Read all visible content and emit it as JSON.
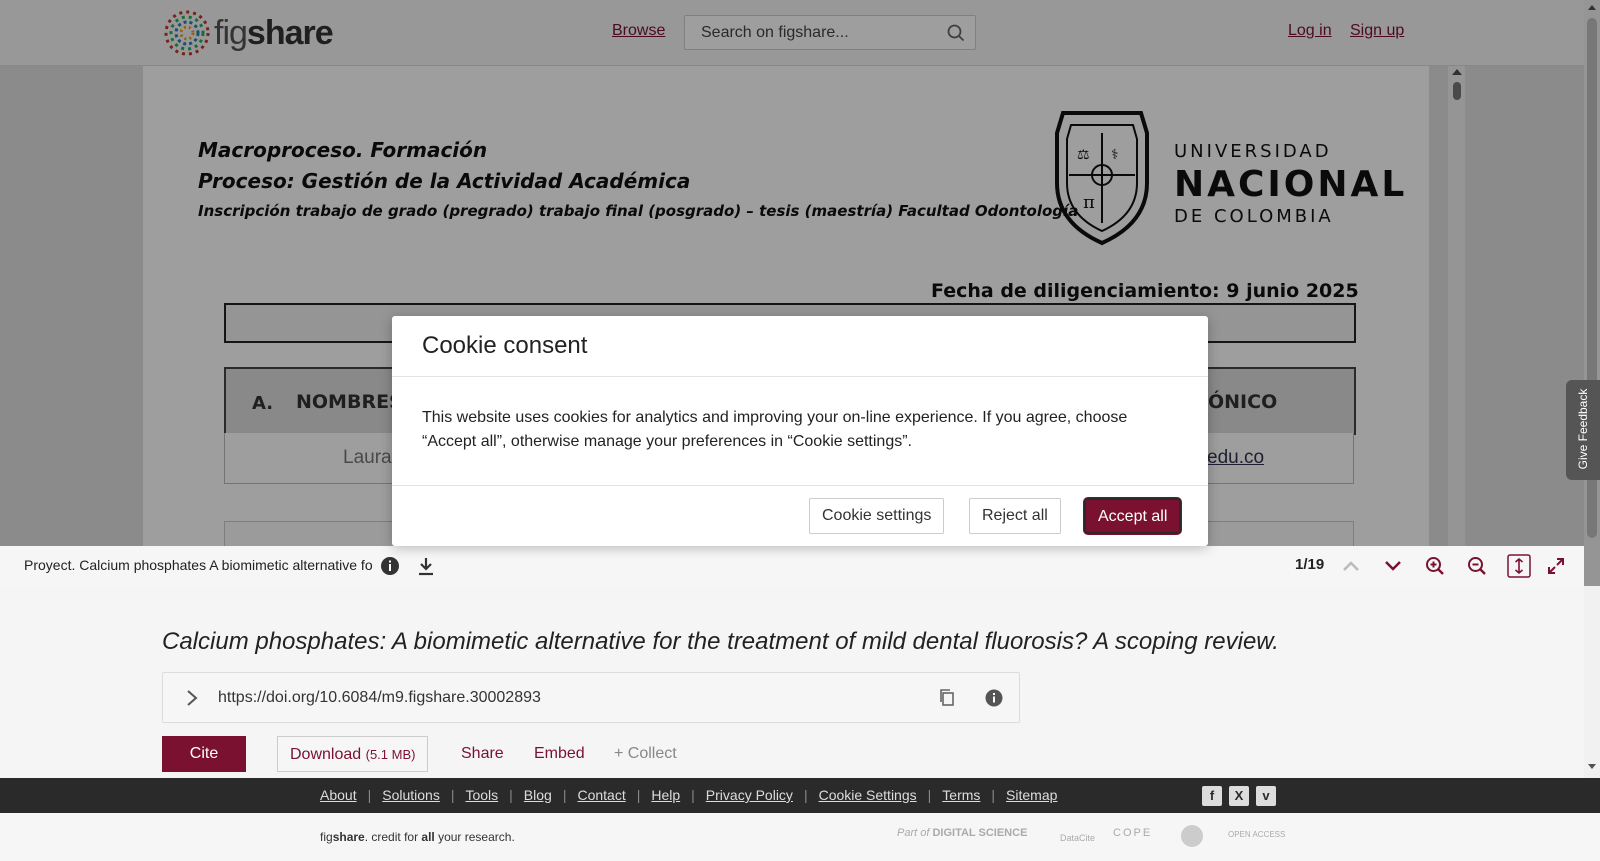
{
  "header": {
    "logo_prefix": "fig",
    "logo_suffix": "share",
    "browse": "Browse",
    "search_placeholder": "Search on figshare...",
    "login": "Log in",
    "signup": "Sign up"
  },
  "document": {
    "line1": "Macroproceso. Formación",
    "line2": "Proceso: Gestión de la Actividad Académica",
    "line3": "Inscripción trabajo de grado (pregrado) trabajo final (posgrado) – tesis (maestría) Facultad Odontología",
    "university1": "UNIVERSIDAD",
    "university2": "NACIONAL",
    "university3": "DE COLOMBIA",
    "fecha": "Fecha de diligenciamiento: 9 junio 2025",
    "table_col_a": "A.",
    "table_col_nombres": "NOMBRES",
    "table_col_email_partial": "ÓNICO",
    "row_name_partial": "Laura",
    "row_email_partial": "edu.co"
  },
  "viewer_toolbar": {
    "file_name": "Proyect. Calcium phosphates A biomimetic alternative fo",
    "page_counter": "1/19"
  },
  "item": {
    "title": "Calcium phosphates: A biomimetic alternative for the treatment of mild dental fluorosis? A scoping review.",
    "doi": "https://doi.org/10.6084/m9.figshare.30002893",
    "cite": "Cite",
    "download": "Download",
    "download_size": "(5.1 MB)",
    "share": "Share",
    "embed": "Embed",
    "collect": "+ Collect"
  },
  "feedback": "Give Feedback",
  "footer": {
    "links": [
      "About",
      "Solutions",
      "Tools",
      "Blog",
      "Contact",
      "Help",
      "Privacy Policy",
      "Cookie Settings",
      "Terms",
      "Sitemap"
    ],
    "tagline_fig": "fig",
    "tagline_share": "share",
    "tagline_mid": ". credit for ",
    "tagline_all": "all",
    "tagline_end": " your research.",
    "partner_part_of": "Part of",
    "partner_ds": "DIGITAL SCIENCE",
    "partner_datacite": "DataCite",
    "partner_cope": "COPE",
    "partner_oa": "OPEN ACCESS"
  },
  "cookie": {
    "title": "Cookie consent",
    "body": "This website uses cookies for analytics and improving your on-line experience. If you agree, choose “Accept all”, otherwise manage your preferences in “Cookie settings”.",
    "settings": "Cookie settings",
    "reject": "Reject all",
    "accept": "Accept all"
  },
  "colors": {
    "brand": "#7b1131",
    "footer_dark": "#2a2a2a"
  }
}
